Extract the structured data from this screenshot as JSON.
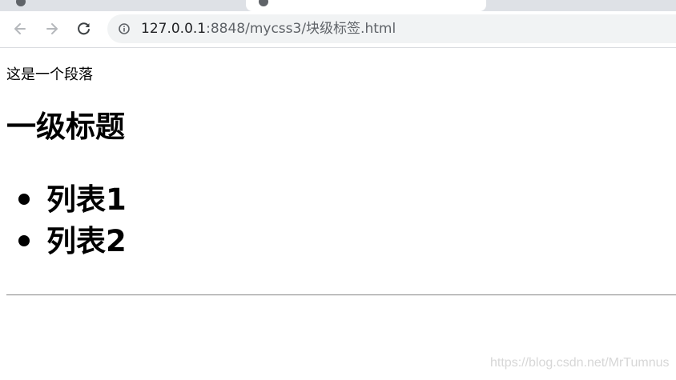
{
  "browser": {
    "url_host": "127.0.0.1",
    "url_path": ":8848/mycss3/块级标签.html"
  },
  "page": {
    "paragraph": "这是一个段落",
    "heading": "一级标题",
    "list_items": [
      "列表1",
      "列表2"
    ]
  },
  "watermark": "https://blog.csdn.net/MrTumnus",
  "icons": {
    "back": "back-arrow-icon",
    "forward": "forward-arrow-icon",
    "reload": "reload-icon",
    "info": "info-icon"
  }
}
